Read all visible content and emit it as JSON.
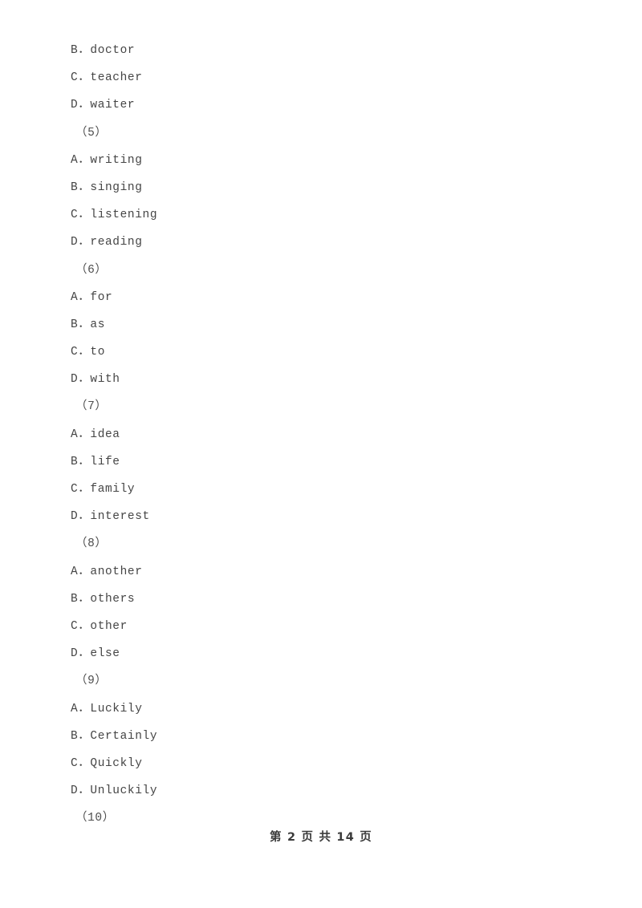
{
  "document": {
    "page_background": "#ffffff",
    "text_color": "#454545",
    "lines": [
      {
        "kind": "option",
        "text": "B．doctor"
      },
      {
        "kind": "option",
        "text": "C．teacher"
      },
      {
        "kind": "option",
        "text": "D．waiter"
      },
      {
        "kind": "question",
        "text": "（5）"
      },
      {
        "kind": "option",
        "text": "A．writing"
      },
      {
        "kind": "option",
        "text": "B．singing"
      },
      {
        "kind": "option",
        "text": "C．listening"
      },
      {
        "kind": "option",
        "text": "D．reading"
      },
      {
        "kind": "question",
        "text": "（6）"
      },
      {
        "kind": "option",
        "text": "A．for"
      },
      {
        "kind": "option",
        "text": "B．as"
      },
      {
        "kind": "option",
        "text": "C．to"
      },
      {
        "kind": "option",
        "text": "D．with"
      },
      {
        "kind": "question",
        "text": "（7）"
      },
      {
        "kind": "option",
        "text": "A．idea"
      },
      {
        "kind": "option",
        "text": "B．life"
      },
      {
        "kind": "option",
        "text": "C．family"
      },
      {
        "kind": "option",
        "text": "D．interest"
      },
      {
        "kind": "question",
        "text": "（8）"
      },
      {
        "kind": "option",
        "text": "A．another"
      },
      {
        "kind": "option",
        "text": "B．others"
      },
      {
        "kind": "option",
        "text": "C．other"
      },
      {
        "kind": "option",
        "text": "D．else"
      },
      {
        "kind": "question",
        "text": "（9）"
      },
      {
        "kind": "option",
        "text": "A．Luckily"
      },
      {
        "kind": "option",
        "text": "B．Certainly"
      },
      {
        "kind": "option",
        "text": "C．Quickly"
      },
      {
        "kind": "option",
        "text": "D．Unluckily"
      },
      {
        "kind": "question",
        "text": "（10）"
      }
    ]
  },
  "footer": {
    "page_indicator": "第 2 页 共 14 页",
    "current_page": 2,
    "total_pages": 14
  }
}
